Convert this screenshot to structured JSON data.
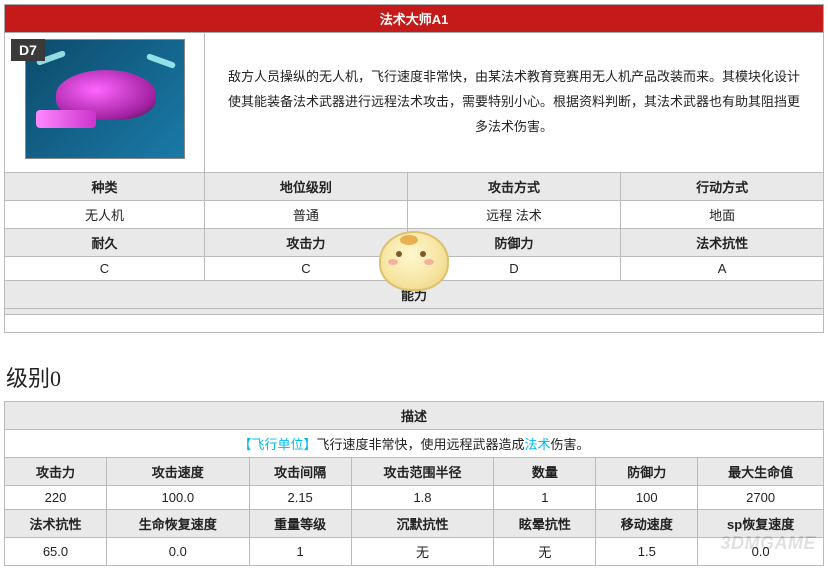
{
  "unit": {
    "name": "法术大师A1",
    "badge": "D7",
    "description": "敌方人员操纵的无人机，飞行速度非常快，由某法术教育竞赛用无人机产品改装而来。其模块化设计使其能装备法术武器进行远程法术攻击，需要特别小心。根据资料判断，其法术武器也有助其阻挡更多法术伤害。"
  },
  "basic": {
    "headers": {
      "type": "种类",
      "rank": "地位级别",
      "atkmode": "攻击方式",
      "movemode": "行动方式"
    },
    "values": {
      "type": "无人机",
      "rank": "普通",
      "atkmode": "远程 法术",
      "movemode": "地面"
    },
    "headers2": {
      "hp": "耐久",
      "atk": "攻击力",
      "def": "防御力",
      "res": "法术抗性"
    },
    "values2": {
      "hp": "C",
      "atk": "C",
      "def": "D",
      "res": "A"
    }
  },
  "ability_label": "能力",
  "level_heading": "级别0",
  "desc2": {
    "title": "描述",
    "prefix": "【飞行单位】",
    "mid1": "飞行速度非常快，使用远程武器造成",
    "tag": "法术",
    "mid2": "伤害。"
  },
  "stats": {
    "row1h": [
      "攻击力",
      "攻击速度",
      "攻击间隔",
      "攻击范围半径",
      "数量",
      "防御力",
      "最大生命值"
    ],
    "row1v": [
      "220",
      "100.0",
      "2.15",
      "1.8",
      "1",
      "100",
      "2700"
    ],
    "row2h": [
      "法术抗性",
      "生命恢复速度",
      "重量等级",
      "沉默抗性",
      "眩晕抗性",
      "移动速度",
      "sp恢复速度"
    ],
    "row2v": [
      "65.0",
      "0.0",
      "1",
      "无",
      "无",
      "1.5",
      "0.0"
    ]
  },
  "watermark": "3DMGAME"
}
